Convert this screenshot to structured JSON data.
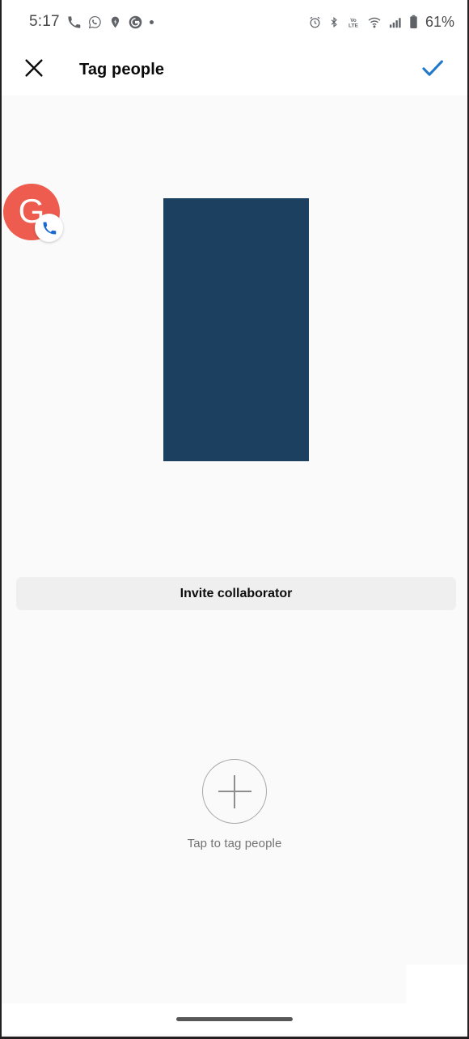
{
  "status_bar": {
    "time": "5:17",
    "left_icons": [
      {
        "name": "phone-call-icon",
        "glyph": "phone"
      },
      {
        "name": "whatsapp-icon",
        "glyph": "whatsapp"
      },
      {
        "name": "location-pin-icon",
        "glyph": "pin"
      },
      {
        "name": "google-g-icon",
        "glyph": "google"
      },
      {
        "name": "notification-dot-icon",
        "glyph": "dot"
      }
    ],
    "right_icons": [
      {
        "name": "alarm-clock-icon",
        "glyph": "alarm"
      },
      {
        "name": "bluetooth-icon",
        "glyph": "bluetooth"
      },
      {
        "name": "volte-icon",
        "glyph": "VoLTE"
      },
      {
        "name": "wifi-icon",
        "glyph": "wifi"
      },
      {
        "name": "cellular-signal-icon",
        "glyph": "signal"
      },
      {
        "name": "battery-icon",
        "glyph": "battery"
      }
    ],
    "battery_percent": "61%"
  },
  "app_bar": {
    "close_label": "close-icon",
    "title": "Tag people",
    "confirm_label": "checkmark-icon",
    "confirm_color": "#2279c9"
  },
  "content": {
    "media": {
      "name": "post-image-preview",
      "color": "#1b4060"
    },
    "invite_button": {
      "label": "Invite collaborator",
      "background": "#efeff0"
    },
    "tag_area": {
      "plus_icon": "plus-icon",
      "label": "Tap to tag people"
    }
  },
  "call_bubble": {
    "initial": "G",
    "avatar_color": "#ed5c4e",
    "badge_icon": "phone-icon",
    "badge_color": "#1967d2"
  },
  "nav_bar": {
    "gesture_pill": "home-gesture-pill"
  }
}
